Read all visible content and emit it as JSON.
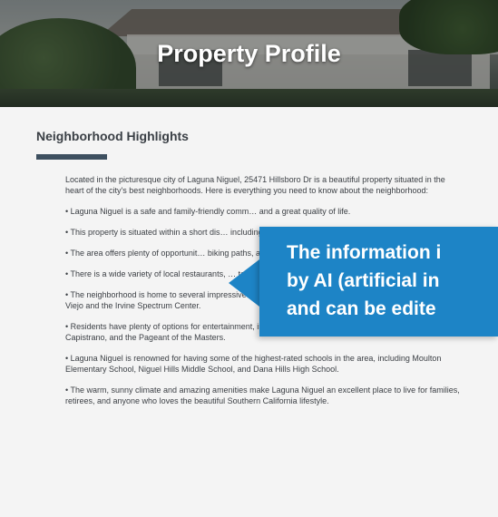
{
  "header": {
    "title": "Property Profile"
  },
  "section": {
    "title": "Neighborhood Highlights"
  },
  "paragraphs": [
    "Located in the picturesque city of Laguna Niguel, 25471 Hillsboro Dr is a beautiful property situated in the heart of the city's best neighborhoods. Here is everything you need to know about the neighborhood:",
    "• Laguna Niguel is a safe and family-friendly comm… and a great quality of life.",
    "• This property is situated within a short dis… including Salt Creek Beach and Laguna Be…",
    "• The area offers plenty of opportunit… biking paths, and golf courses.",
    "• There is a wide variety of local restaurants, … tastes and preferences.",
    "• The neighborhood is home to several impressive shopping destinations, including The Shops at Mission Viejo and the Irvine Spectrum Center.",
    "• Residents have plenty of options for entertainment, including the Laguna Playhouse, the Mission San Juan Capistrano, and the Pageant of the Masters.",
    "• Laguna Niguel is renowned for having some of the highest-rated schools in the area, including Moulton Elementary School, Niguel Hills Middle School, and Dana Hills High School.",
    "• The warm, sunny climate and amazing amenities make Laguna Niguel an excellent place to live for families, retirees, and anyone who loves the beautiful Southern California lifestyle."
  ],
  "callout": {
    "line1": "The information i",
    "line2": "by AI (artificial in",
    "line3": "and can be edite"
  },
  "colors": {
    "callout_blue": "#1d84c6",
    "underline": "#3d4f5f"
  }
}
